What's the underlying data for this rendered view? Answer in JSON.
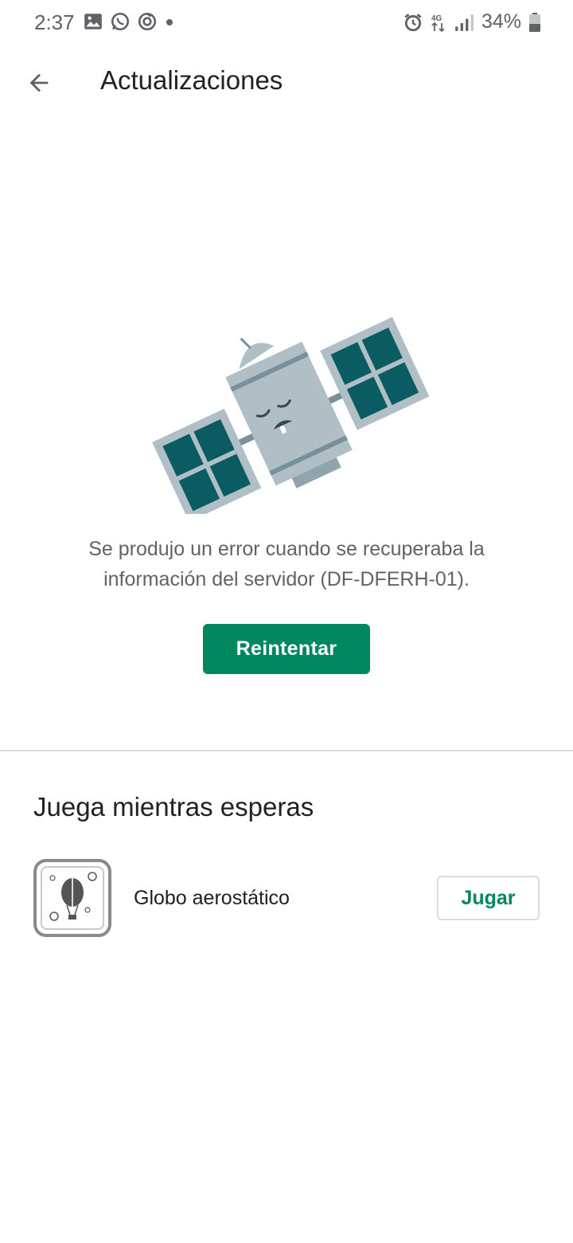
{
  "status_bar": {
    "time": "2:37",
    "battery": "34%",
    "left_icons": [
      "image-icon",
      "whatsapp-icon",
      "sync-icon",
      "dot-icon"
    ],
    "right_icons": [
      "alarm-icon",
      "4g-icon",
      "signal-icon",
      "battery-icon"
    ]
  },
  "header": {
    "title": "Actualizaciones"
  },
  "error": {
    "message": "Se produjo un error cuando se recuperaba la información del servidor (DF-DFERH-01).",
    "retry_label": "Reintentar"
  },
  "section": {
    "heading": "Juega mientras esperas",
    "game": {
      "title": "Globo aerostático",
      "play_label": "Jugar"
    }
  },
  "colors": {
    "accent": "#01875f",
    "satellite_panel": "#0b5b63",
    "satellite_body": "#b0bec5"
  }
}
